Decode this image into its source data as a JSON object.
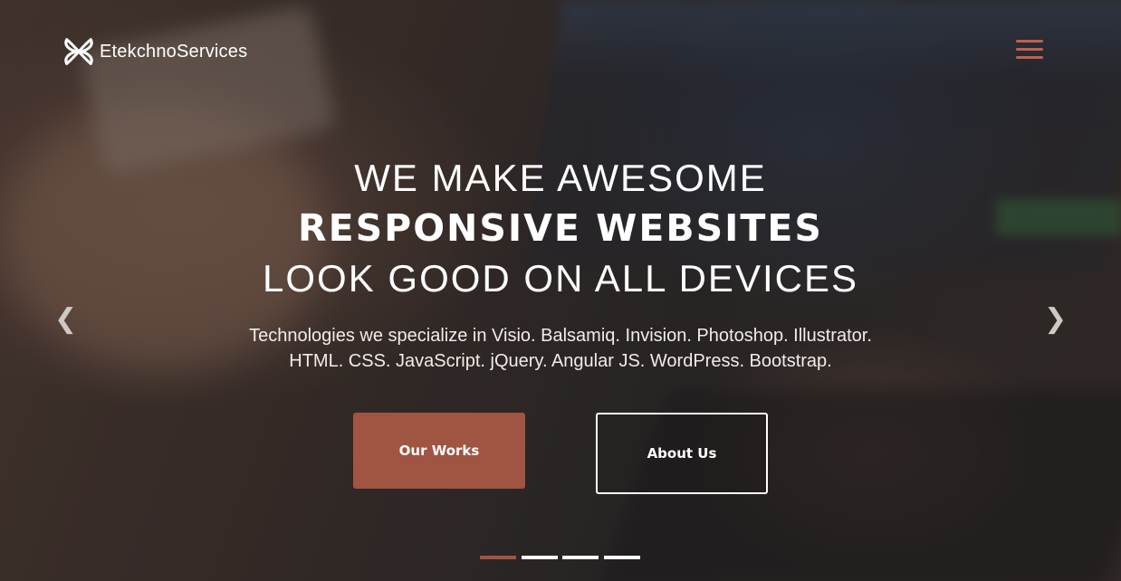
{
  "brand": {
    "name": "EtekchnoServices",
    "logo_icon": "x-knot-logo-icon"
  },
  "header": {
    "menu_icon": "hamburger-menu-icon",
    "accent_color": "#c25f4a"
  },
  "hero": {
    "line1": "WE MAKE AWESOME",
    "line2": "RESPONSIVE WEBSITES",
    "line3": "LOOK GOOD ON ALL DEVICES",
    "subtitle_line1": "Technologies we specialize in Visio. Balsamiq. Invision. Photoshop. Illustrator.",
    "subtitle_line2": "HTML. CSS. JavaScript. jQuery. Angular JS. WordPress. Bootstrap."
  },
  "buttons": {
    "our_works": "Our Works",
    "about_us": "About Us",
    "primary_color": "#a05442"
  },
  "carousel": {
    "prev_icon": "chevron-left-icon",
    "next_icon": "chevron-right-icon",
    "prev_glyph": "❮",
    "next_glyph": "❯",
    "slide_count": 4,
    "active_index": 0
  }
}
